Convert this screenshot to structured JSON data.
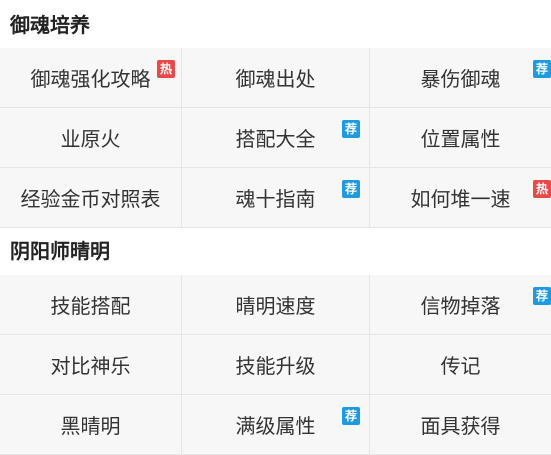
{
  "colors": {
    "hot_badge": "#e84a4a",
    "rec_badge": "#1e9be0"
  },
  "sections": [
    {
      "title": "御魂培养",
      "items": [
        {
          "label": "御魂强化攻略",
          "badge": "热",
          "badge_type": "hot"
        },
        {
          "label": "御魂出处",
          "badge": null,
          "badge_type": null
        },
        {
          "label": "暴伤御魂",
          "badge": "荐",
          "badge_type": "rec"
        },
        {
          "label": "业原火",
          "badge": null,
          "badge_type": null
        },
        {
          "label": "搭配大全",
          "badge": "荐",
          "badge_type": "rec"
        },
        {
          "label": "位置属性",
          "badge": null,
          "badge_type": null
        },
        {
          "label": "经验金币对照表",
          "badge": null,
          "badge_type": null
        },
        {
          "label": "魂十指南",
          "badge": "荐",
          "badge_type": "rec"
        },
        {
          "label": "如何堆一速",
          "badge": "热",
          "badge_type": "hot"
        }
      ]
    },
    {
      "title": "阴阳师晴明",
      "items": [
        {
          "label": "技能搭配",
          "badge": null,
          "badge_type": null
        },
        {
          "label": "晴明速度",
          "badge": null,
          "badge_type": null
        },
        {
          "label": "信物掉落",
          "badge": "荐",
          "badge_type": "rec"
        },
        {
          "label": "对比神乐",
          "badge": null,
          "badge_type": null
        },
        {
          "label": "技能升级",
          "badge": null,
          "badge_type": null
        },
        {
          "label": "传记",
          "badge": null,
          "badge_type": null
        },
        {
          "label": "黑晴明",
          "badge": null,
          "badge_type": null
        },
        {
          "label": "满级属性",
          "badge": "荐",
          "badge_type": "rec"
        },
        {
          "label": "面具获得",
          "badge": null,
          "badge_type": null
        }
      ]
    }
  ]
}
